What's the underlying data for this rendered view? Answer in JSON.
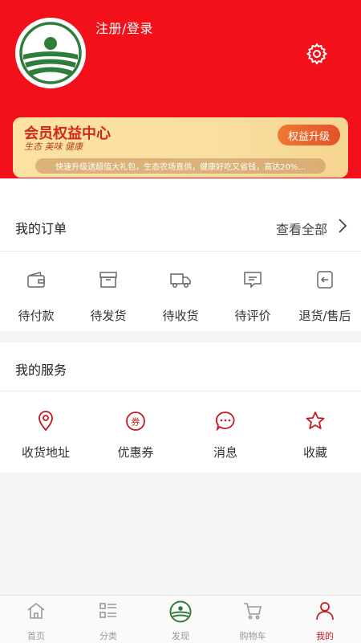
{
  "header": {
    "auth_link": "注册/登录",
    "icons": {
      "avatar": "farm-logo",
      "settings": "gear-icon"
    }
  },
  "member_card": {
    "title": "会员权益中心",
    "subtitle": "生态 美味 健康",
    "upgrade_label": "权益升级",
    "tip": "快速升级送超值大礼包，生态农场直供，健康好吃又省钱，高达20%..."
  },
  "orders": {
    "title": "我的订单",
    "view_all": "查看全部",
    "items": [
      {
        "label": "待付款",
        "icon": "wallet-icon"
      },
      {
        "label": "待发货",
        "icon": "box-icon"
      },
      {
        "label": "待收货",
        "icon": "truck-icon"
      },
      {
        "label": "待评价",
        "icon": "comment-icon"
      },
      {
        "label": "退货/售后",
        "icon": "return-icon"
      }
    ]
  },
  "services": {
    "title": "我的服务",
    "items": [
      {
        "label": "收货地址",
        "icon": "location-pin-icon"
      },
      {
        "label": "优惠券",
        "icon": "coupon-icon"
      },
      {
        "label": "消息",
        "icon": "message-icon"
      },
      {
        "label": "收藏",
        "icon": "star-icon"
      }
    ]
  },
  "tabbar": {
    "items": [
      {
        "label": "首页",
        "icon": "home-icon"
      },
      {
        "label": "分类",
        "icon": "category-icon"
      },
      {
        "label": "发现",
        "icon": "farm-logo-icon"
      },
      {
        "label": "购物车",
        "icon": "cart-icon"
      },
      {
        "label": "我的",
        "icon": "user-icon"
      }
    ],
    "active": "我的"
  },
  "colors": {
    "header_bg": "#f2101a",
    "accent_red": "#c31a22",
    "card_gold": "#fbe2a3",
    "upgrade_orange": "#e9632d",
    "logo_green": "#2f7d3a"
  }
}
